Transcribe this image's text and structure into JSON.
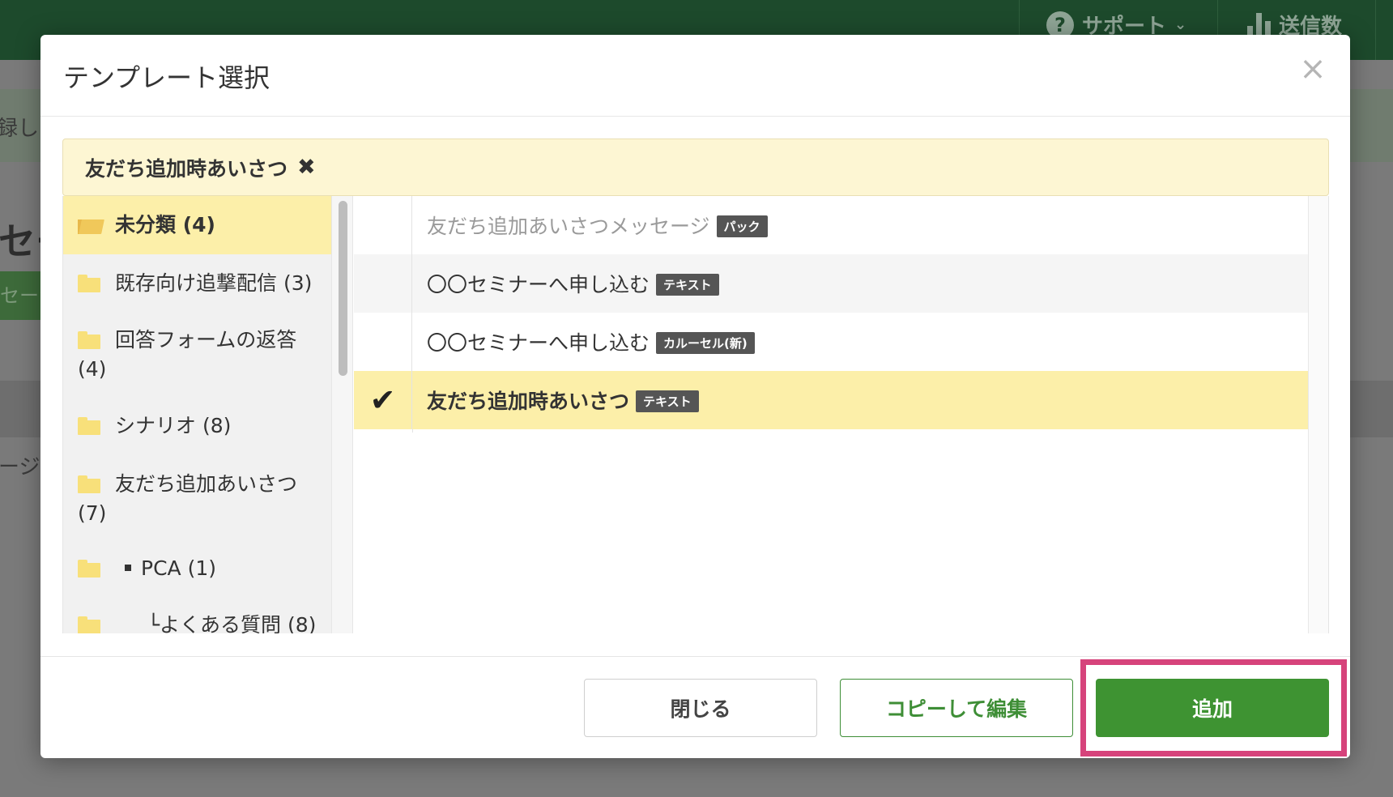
{
  "background": {
    "nav_support": "サポート",
    "nav_sent": "送信数",
    "fragment_1": "録しま",
    "fragment_2": "セー",
    "fragment_3": "セージ",
    "fragment_4": "ージ"
  },
  "modal": {
    "title": "テンプレート選択",
    "close_icon": "×",
    "filter": {
      "label": "友だち追加時あいさつ",
      "remove_icon": "✖"
    },
    "folders": [
      {
        "label": "未分類",
        "count": "(4)",
        "active": true
      },
      {
        "label": "既存向け追撃配信",
        "count": "(3)"
      },
      {
        "label": "回答フォームの返答",
        "count": "(4)"
      },
      {
        "label": "シナリオ",
        "count": "(8)"
      },
      {
        "label": "友だち追加あいさつ",
        "count": "(7)"
      },
      {
        "label": "PCA",
        "count": "(1)"
      },
      {
        "label": "└よくある質問",
        "count": "(8)"
      }
    ],
    "templates": [
      {
        "name": "友だち追加あいさつメッセージ",
        "tag": "パック",
        "state": "muted"
      },
      {
        "name": "〇〇セミナーへ申し込む",
        "tag": "テキスト",
        "state": "alt"
      },
      {
        "name": "〇〇セミナーへ申し込む",
        "tag": "カルーセル(新)",
        "state": ""
      },
      {
        "name": "友だち追加時あいさつ",
        "tag": "テキスト",
        "state": "selected",
        "check": "✔"
      }
    ],
    "buttons": {
      "close": "閉じる",
      "copy_edit": "コピーして編集",
      "add": "追加"
    }
  },
  "colors": {
    "header_green": "#1d4a2c",
    "selection_yellow": "#fcefa9",
    "filter_yellow": "#fdf6d3",
    "primary_green": "#3e9332",
    "highlight_pink": "#d6437b"
  }
}
